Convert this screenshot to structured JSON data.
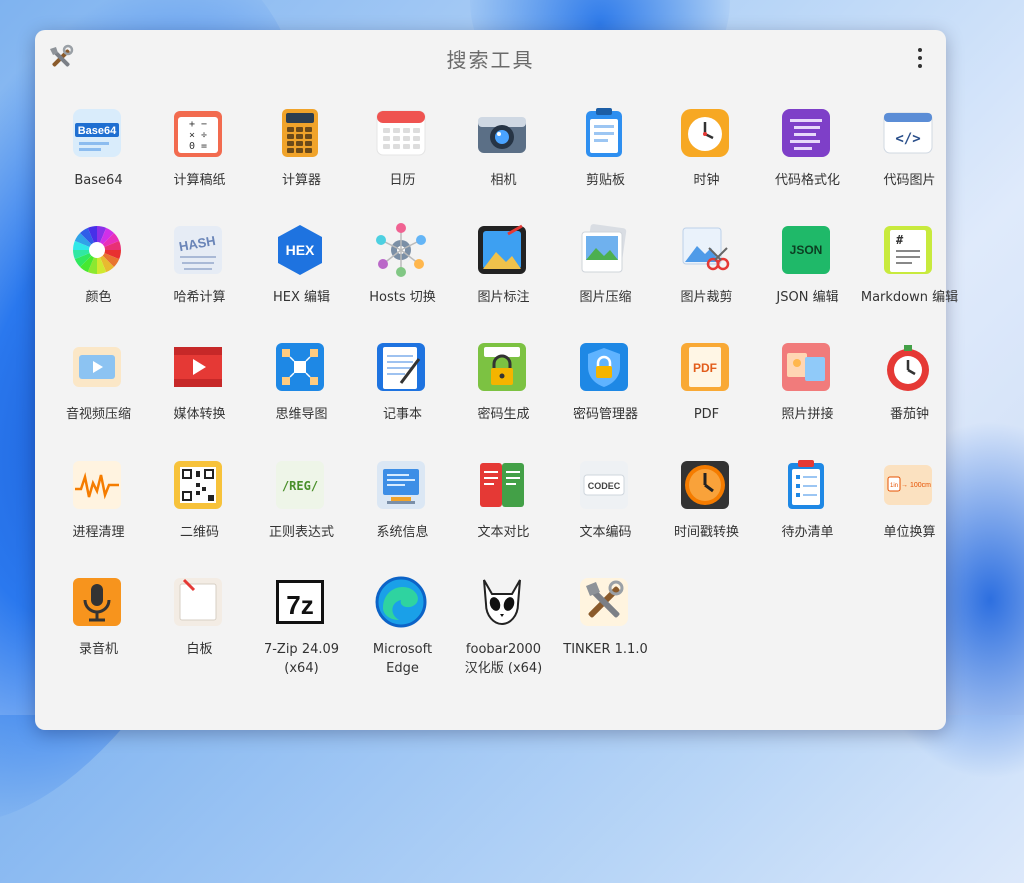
{
  "window": {
    "title": "搜索工具",
    "menu_icon": "more-vertical-icon",
    "app_icon": "tools-icon"
  },
  "tools": [
    {
      "label": "Base64",
      "icon": "base64-icon"
    },
    {
      "label": "计算稿纸",
      "icon": "calc-paper-icon"
    },
    {
      "label": "计算器",
      "icon": "calculator-icon"
    },
    {
      "label": "日历",
      "icon": "calendar-icon"
    },
    {
      "label": "相机",
      "icon": "camera-icon"
    },
    {
      "label": "剪贴板",
      "icon": "clipboard-icon"
    },
    {
      "label": "时钟",
      "icon": "clock-icon"
    },
    {
      "label": "代码格式化",
      "icon": "code-format-icon"
    },
    {
      "label": "代码图片",
      "icon": "code-image-icon"
    },
    {
      "label": "颜色",
      "icon": "color-wheel-icon"
    },
    {
      "label": "哈希计算",
      "icon": "hash-icon"
    },
    {
      "label": "HEX 编辑",
      "icon": "hex-icon"
    },
    {
      "label": "Hosts 切换",
      "icon": "network-icon"
    },
    {
      "label": "图片标注",
      "icon": "image-annotate-icon"
    },
    {
      "label": "图片压缩",
      "icon": "image-compress-icon"
    },
    {
      "label": "图片裁剪",
      "icon": "image-crop-icon"
    },
    {
      "label": "JSON 编辑",
      "icon": "json-icon"
    },
    {
      "label": "Markdown 编辑",
      "icon": "markdown-icon"
    },
    {
      "label": "音视频压缩",
      "icon": "video-compress-icon"
    },
    {
      "label": "媒体转换",
      "icon": "media-convert-icon"
    },
    {
      "label": "思维导图",
      "icon": "mind-map-icon"
    },
    {
      "label": "记事本",
      "icon": "notepad-icon"
    },
    {
      "label": "密码生成",
      "icon": "password-generate-icon"
    },
    {
      "label": "密码管理器",
      "icon": "password-manager-icon"
    },
    {
      "label": "PDF",
      "icon": "pdf-icon"
    },
    {
      "label": "照片拼接",
      "icon": "photo-stitch-icon"
    },
    {
      "label": "番茄钟",
      "icon": "tomato-timer-icon"
    },
    {
      "label": "进程清理",
      "icon": "process-clean-icon"
    },
    {
      "label": "二维码",
      "icon": "qr-code-icon"
    },
    {
      "label": "正则表达式",
      "icon": "regex-icon"
    },
    {
      "label": "系统信息",
      "icon": "system-info-icon"
    },
    {
      "label": "文本对比",
      "icon": "text-compare-icon"
    },
    {
      "label": "文本编码",
      "icon": "codec-icon"
    },
    {
      "label": "时间戳转换",
      "icon": "timestamp-icon"
    },
    {
      "label": "待办清单",
      "icon": "todo-icon"
    },
    {
      "label": "单位换算",
      "icon": "unit-convert-icon"
    },
    {
      "label": "录音机",
      "icon": "microphone-icon"
    },
    {
      "label": "白板",
      "icon": "whiteboard-icon"
    },
    {
      "label": "7-Zip 24.09\n(x64)",
      "icon": "7zip-icon"
    },
    {
      "label": "Microsoft\nEdge",
      "icon": "edge-icon"
    },
    {
      "label": "foobar2000\n汉化版 (x64)",
      "icon": "foobar-icon"
    },
    {
      "label": "TINKER 1.1.0",
      "icon": "tinker-icon"
    }
  ],
  "badges": {
    "base64": "Base64",
    "hex": "HEX",
    "hash": "HASH",
    "json": "JSON",
    "regex": "/REG/",
    "codec": "CODEC",
    "pdf": "PDF",
    "sevenzip": "7z",
    "unit_a": "1in",
    "unit_b": "→ 100cm",
    "code_img": "</>",
    "markdown": "#",
    "calc_keys": "+ −\n× ÷\n0 ="
  }
}
